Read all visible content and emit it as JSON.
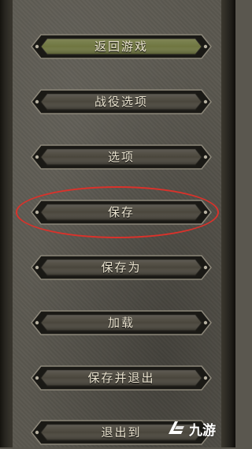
{
  "menu": {
    "items": [
      {
        "label": "返回游戏",
        "active": true
      },
      {
        "label": "战役选项",
        "active": false
      },
      {
        "label": "选项",
        "active": false
      },
      {
        "label": "保存",
        "active": false,
        "highlighted": true
      },
      {
        "label": "保存为",
        "active": false
      },
      {
        "label": "加载",
        "active": false
      },
      {
        "label": "保存并退出",
        "active": false
      },
      {
        "label": "退出到",
        "active": false
      }
    ]
  },
  "colors": {
    "active_fill": "#6f7640",
    "normal_fill": "#4a463c",
    "highlight_ring": "#d9322b",
    "label_text": "#eae3cf"
  },
  "watermark": {
    "text": "九游",
    "icon": "jiuyou-logo-icon"
  }
}
